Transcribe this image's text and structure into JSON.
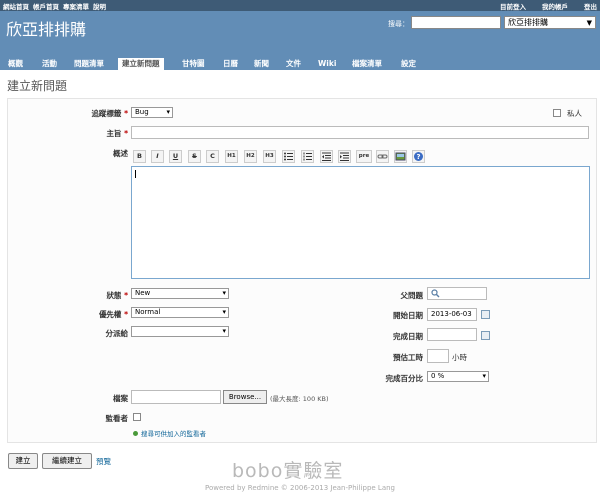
{
  "top_menu": {
    "links": [
      "網站首頁",
      "帳戶首頁",
      "專案清單",
      "說明"
    ],
    "login_status": "目前登入",
    "my_account": "我的帳戶",
    "logout": "登出"
  },
  "header": {
    "title": "欣亞排排購",
    "search_label": "搜尋：",
    "search_value": "",
    "project_select": "欣亞排排購"
  },
  "main_menu": {
    "tabs": [
      "概觀",
      "活動",
      "問題清單",
      "建立新問題",
      "甘特圖",
      "日曆",
      "新聞",
      "文件",
      "Wiki",
      "檔案清單",
      "設定"
    ],
    "selected": "建立新問題"
  },
  "page": {
    "title": "建立新問題"
  },
  "form": {
    "tracker_label": "追蹤標籤",
    "tracker_value": "Bug",
    "private_label": "私人",
    "subject_label": "主旨",
    "subject_value": "",
    "description_label": "概述",
    "toolbar": [
      "B",
      "I",
      "U",
      "S",
      "C",
      "H1",
      "H2",
      "H3",
      "ul",
      "ol",
      "indent-left",
      "indent-right",
      "pre",
      "link",
      "image",
      "help"
    ],
    "toolbar_text": {
      "b": "B",
      "i": "I",
      "u": "U",
      "s": "S",
      "c": "C",
      "h1": "H1",
      "h2": "H2",
      "h3": "H3",
      "pre": "pre"
    },
    "status_label": "狀態",
    "status_value": "New",
    "priority_label": "優先權",
    "priority_value": "Normal",
    "assignee_label": "分派給",
    "assignee_value": "",
    "parent_label": "父問題",
    "start_date_label": "開始日期",
    "start_date_value": "2013-06-03",
    "due_date_label": "完成日期",
    "due_date_value": "",
    "estimated_label": "預估工時",
    "estimated_value": "",
    "estimated_unit": "小時",
    "done_label": "完成百分比",
    "done_value": "0 %",
    "file_label": "檔案",
    "browse_button": "Browse...",
    "max_size": "(最大長度: 100 KB)",
    "watchers_label": "監看者",
    "watchers_hint": "搜尋可供加入的監看者"
  },
  "actions": {
    "create": "建立",
    "create_continue": "繼續建立",
    "preview": "預覽"
  },
  "footer": {
    "text": "Powered by Redmine © 2006-2013 Jean-Philippe Lang"
  },
  "watermark": "bobo實驗室",
  "colors": {
    "top_menu_bg": "#3e5b76",
    "header_bg": "#628db6",
    "required": "#bb0000",
    "link": "#169"
  },
  "icons": [
    "search-icon",
    "calendar-icon",
    "add-watcher-icon"
  ]
}
